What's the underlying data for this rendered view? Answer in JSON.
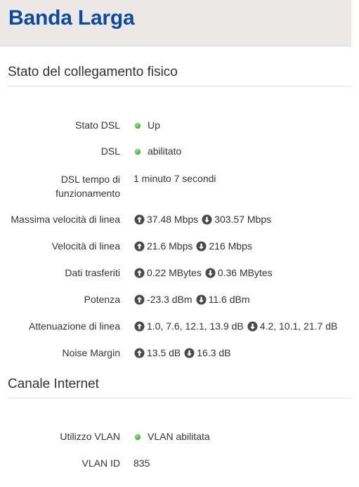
{
  "header": {
    "title": "Banda Larga"
  },
  "colors": {
    "brand": "#0b4a9e",
    "status_ok": "#43b535",
    "header_bg": "#ebe8e6"
  },
  "sections": {
    "physical": {
      "title": "Stato del collegamento fisico",
      "rows": {
        "dsl_state": {
          "label": "Stato DSL",
          "value": "Up",
          "icon": "green-dot-icon"
        },
        "dsl": {
          "label": "DSL",
          "value": "abilitato",
          "icon": "green-dot-icon"
        },
        "uptime": {
          "label": "DSL tempo di funzionamento",
          "value": "1 minuto 7 secondi"
        },
        "max_speed": {
          "label": "Massima velocità di linea",
          "up": "37.48 Mbps",
          "down": "303.57 Mbps"
        },
        "speed": {
          "label": "Velocità di linea",
          "up": "21.6 Mbps",
          "down": "216 Mbps"
        },
        "data": {
          "label": "Dati trasferiti",
          "up": "0.22 MBytes",
          "down": "0.36 MBytes"
        },
        "power": {
          "label": "Potenza",
          "up": "-23.3 dBm",
          "down": "11.6 dBm"
        },
        "attenuation": {
          "label": "Attenuazione di linea",
          "up": "1.0, 7.6, 12.1, 13.9 dB",
          "down": "4.2, 10.1, 21.7 dB"
        },
        "noise": {
          "label": "Noise Margin",
          "up": "13.5 dB",
          "down": "16.3 dB"
        }
      }
    },
    "internet": {
      "title": "Canale Internet",
      "rows": {
        "vlan_usage": {
          "label": "Utilizzo VLAN",
          "value": "VLAN abilitata",
          "icon": "green-dot-icon"
        },
        "vlan_id": {
          "label": "VLAN ID",
          "value": "835"
        }
      }
    }
  },
  "icons": {
    "up": "arrow-up-circle-icon",
    "down": "arrow-down-circle-icon"
  }
}
